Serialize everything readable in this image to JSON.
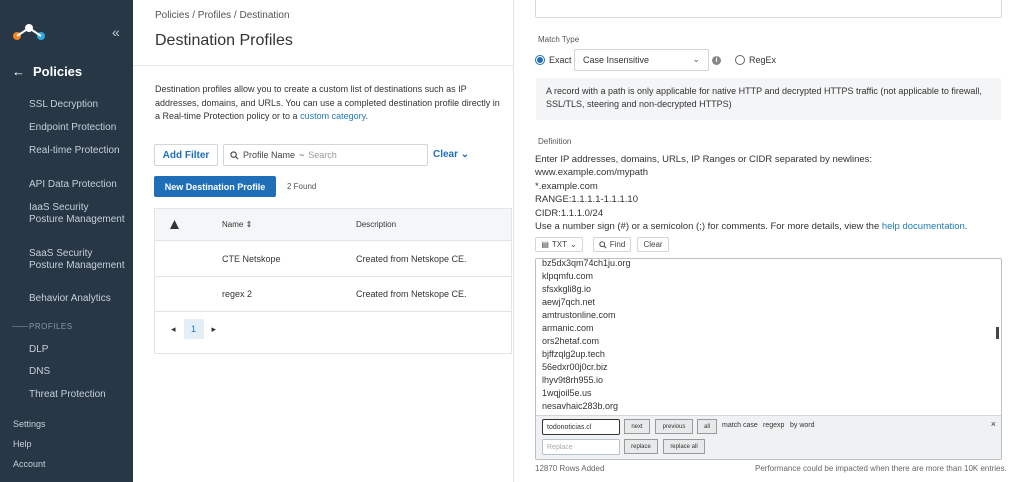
{
  "sidebar": {
    "title": "Policies",
    "items": [
      {
        "label": "SSL Decryption"
      },
      {
        "label": "Endpoint Protection"
      },
      {
        "label": "Real-time Protection"
      },
      {
        "label": "API Data Protection"
      },
      {
        "label": "IaaS Security Posture Management"
      },
      {
        "label": "SaaS Security Posture Management"
      },
      {
        "label": "Behavior Analytics"
      }
    ],
    "section_label": "PROFILES",
    "profile_items": [
      {
        "label": "DLP"
      },
      {
        "label": "DNS"
      },
      {
        "label": "Threat Protection"
      }
    ],
    "bottom": [
      {
        "label": "Settings"
      },
      {
        "label": "Help"
      },
      {
        "label": "Account"
      }
    ]
  },
  "main": {
    "breadcrumb": "Policies / Profiles / Destination",
    "title": "Destination Profiles",
    "description": "Destination profiles allow you to create a custom list of destinations such as IP addresses, domains, and URLs. You can use a completed destination profile directly in a Real-time Protection policy or to a",
    "description_link": "custom category",
    "description_end": ".",
    "add_filter": "Add Filter",
    "search_field": "Profile Name",
    "search_op": "~",
    "search_placeholder": "Search",
    "clear": "Clear",
    "new_button": "New Destination Profile",
    "found": "2 Found",
    "table": {
      "columns": [
        "Name ⇕",
        "Description"
      ],
      "rows": [
        {
          "name": "CTE Netskope",
          "description": "Created from Netskope CE."
        },
        {
          "name": "regex 2",
          "description": "Created from Netskope CE."
        }
      ]
    },
    "pager": {
      "page": "1"
    }
  },
  "panel": {
    "match_type_label": "Match Type",
    "exact_label": "Exact",
    "select_value": "Case Insensitive",
    "regex_label": "RegEx",
    "note": "A record with a path is only applicable for native HTTP and decrypted HTTPS traffic (not applicable to firewall, SSL/TLS, steering and non-decrypted HTTPS)",
    "definition_label": "Definition",
    "definition_lines": [
      "Enter IP addresses, domains, URLs, IP Ranges or CIDR separated by newlines:",
      "www.example.com/mypath",
      "*.example.com",
      "RANGE:1.1.1.1-1.1.1.10",
      "CIDR:1.1.1.0/24"
    ],
    "definition_comment": "Use a number sign (#) or a semicolon (;) for comments. For more details, view the",
    "help_link": "help documentation",
    "help_end": ".",
    "txt_button": "TXT",
    "find_button": "Find",
    "clear_button": "Clear",
    "editor_lines": [
      "bz5dx3qm74ch1ju.org",
      "klpqmfu.com",
      "sfsxkgli8g.io",
      "aewj7qch.net",
      "amtrustonline.com",
      "armanic.com",
      "ors2hetaf.com",
      "bjffzqlg2up.tech",
      "56edxr00j0cr.biz",
      "lhyv9t8rh955.io",
      "1wqjoil5e.us",
      "nesavhaic283b.org"
    ],
    "search_value": "todonoticias.cl",
    "replace_placeholder": "Replace",
    "next": "next",
    "previous": "previous",
    "all": "all",
    "match_case": "match case",
    "regexp": "regexp",
    "by_word": "by word",
    "replace": "replace",
    "replace_all": "replace all",
    "rows_added": "12870 Rows Added",
    "performance_note": "Performance could be impacted when there are more than 10K entries."
  }
}
